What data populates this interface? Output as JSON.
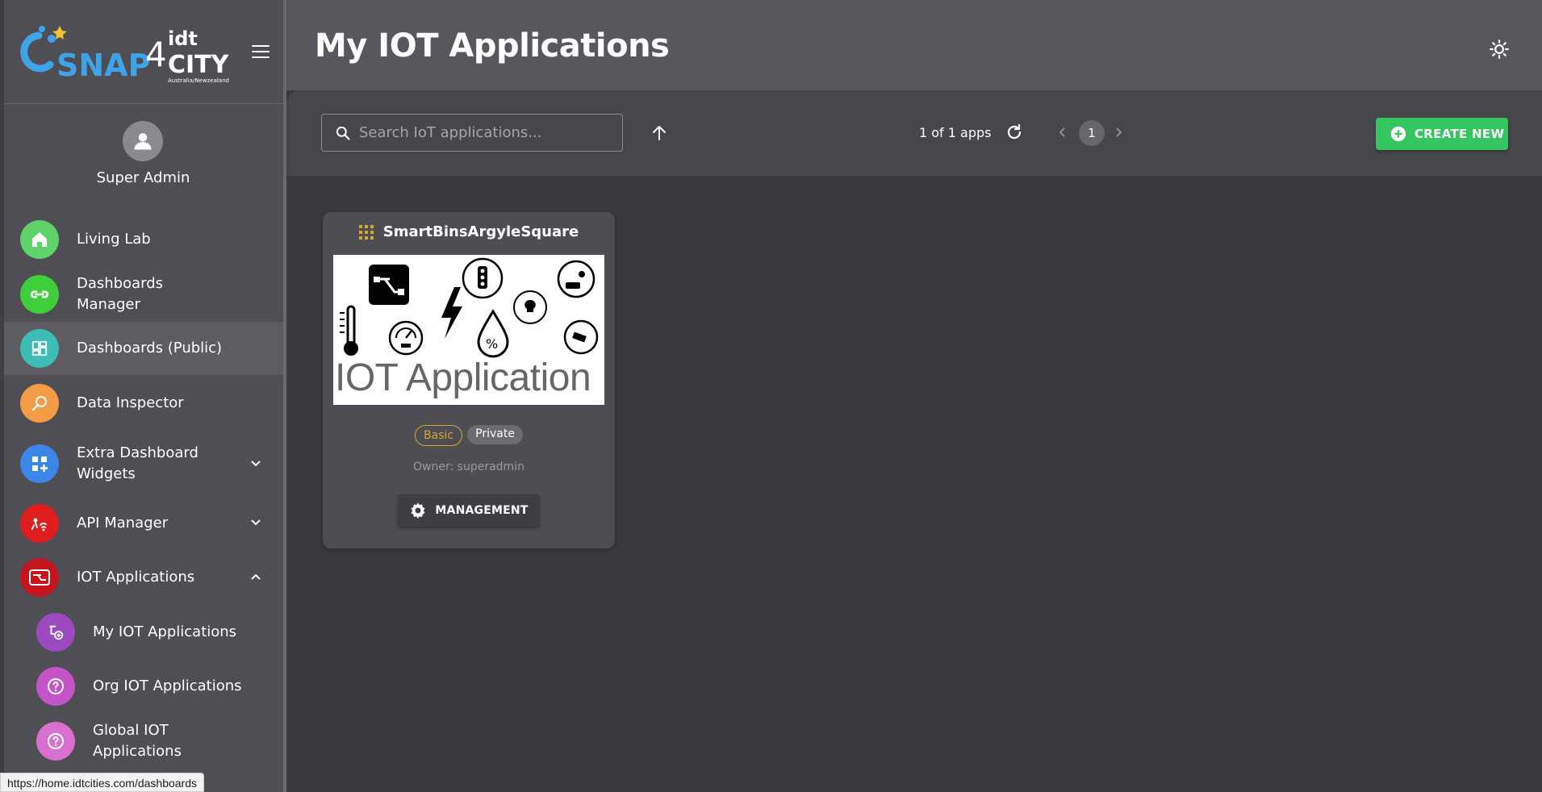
{
  "sidebar": {
    "logo_text": "SNAP4CITY",
    "logo_sub": "Australia/Newzealand",
    "user_name": "Super Admin",
    "items": [
      {
        "label": "Living Lab",
        "color": "#5fd36a"
      },
      {
        "label": "Dashboards Manager",
        "color": "#3fcf3a"
      },
      {
        "label": "Dashboards (Public)",
        "color": "#3dbdb5"
      },
      {
        "label": "Data Inspector",
        "color": "#f39c45"
      },
      {
        "label": "Extra Dashboard Widgets",
        "color": "#3a87e6"
      },
      {
        "label": "API Manager",
        "color": "#e01d1d"
      },
      {
        "label": "IOT Applications",
        "color": "#c4141c"
      }
    ],
    "subitems": [
      {
        "label": "My IOT Applications",
        "color": "#9b4bbd"
      },
      {
        "label": "Org IOT Applications",
        "color": "#c554c9"
      },
      {
        "label": "Global IOT Applications",
        "color": "#d970d0"
      }
    ]
  },
  "status_url": "https://home.idtcities.com/dashboards",
  "header": {
    "title": "My IOT Applications"
  },
  "toolbar": {
    "search_placeholder": "Search IoT applications...",
    "count": "1 of 1 apps",
    "page": "1",
    "create_label": "CREATE NEW",
    "create_color": "#35c561"
  },
  "card": {
    "title": "SmartBinsArgyleSquare",
    "image_label": "IOT Application",
    "badge_level": "Basic",
    "badge_visibility": "Private",
    "owner": "Owner: superadmin",
    "management_label": "MANAGEMENT"
  }
}
